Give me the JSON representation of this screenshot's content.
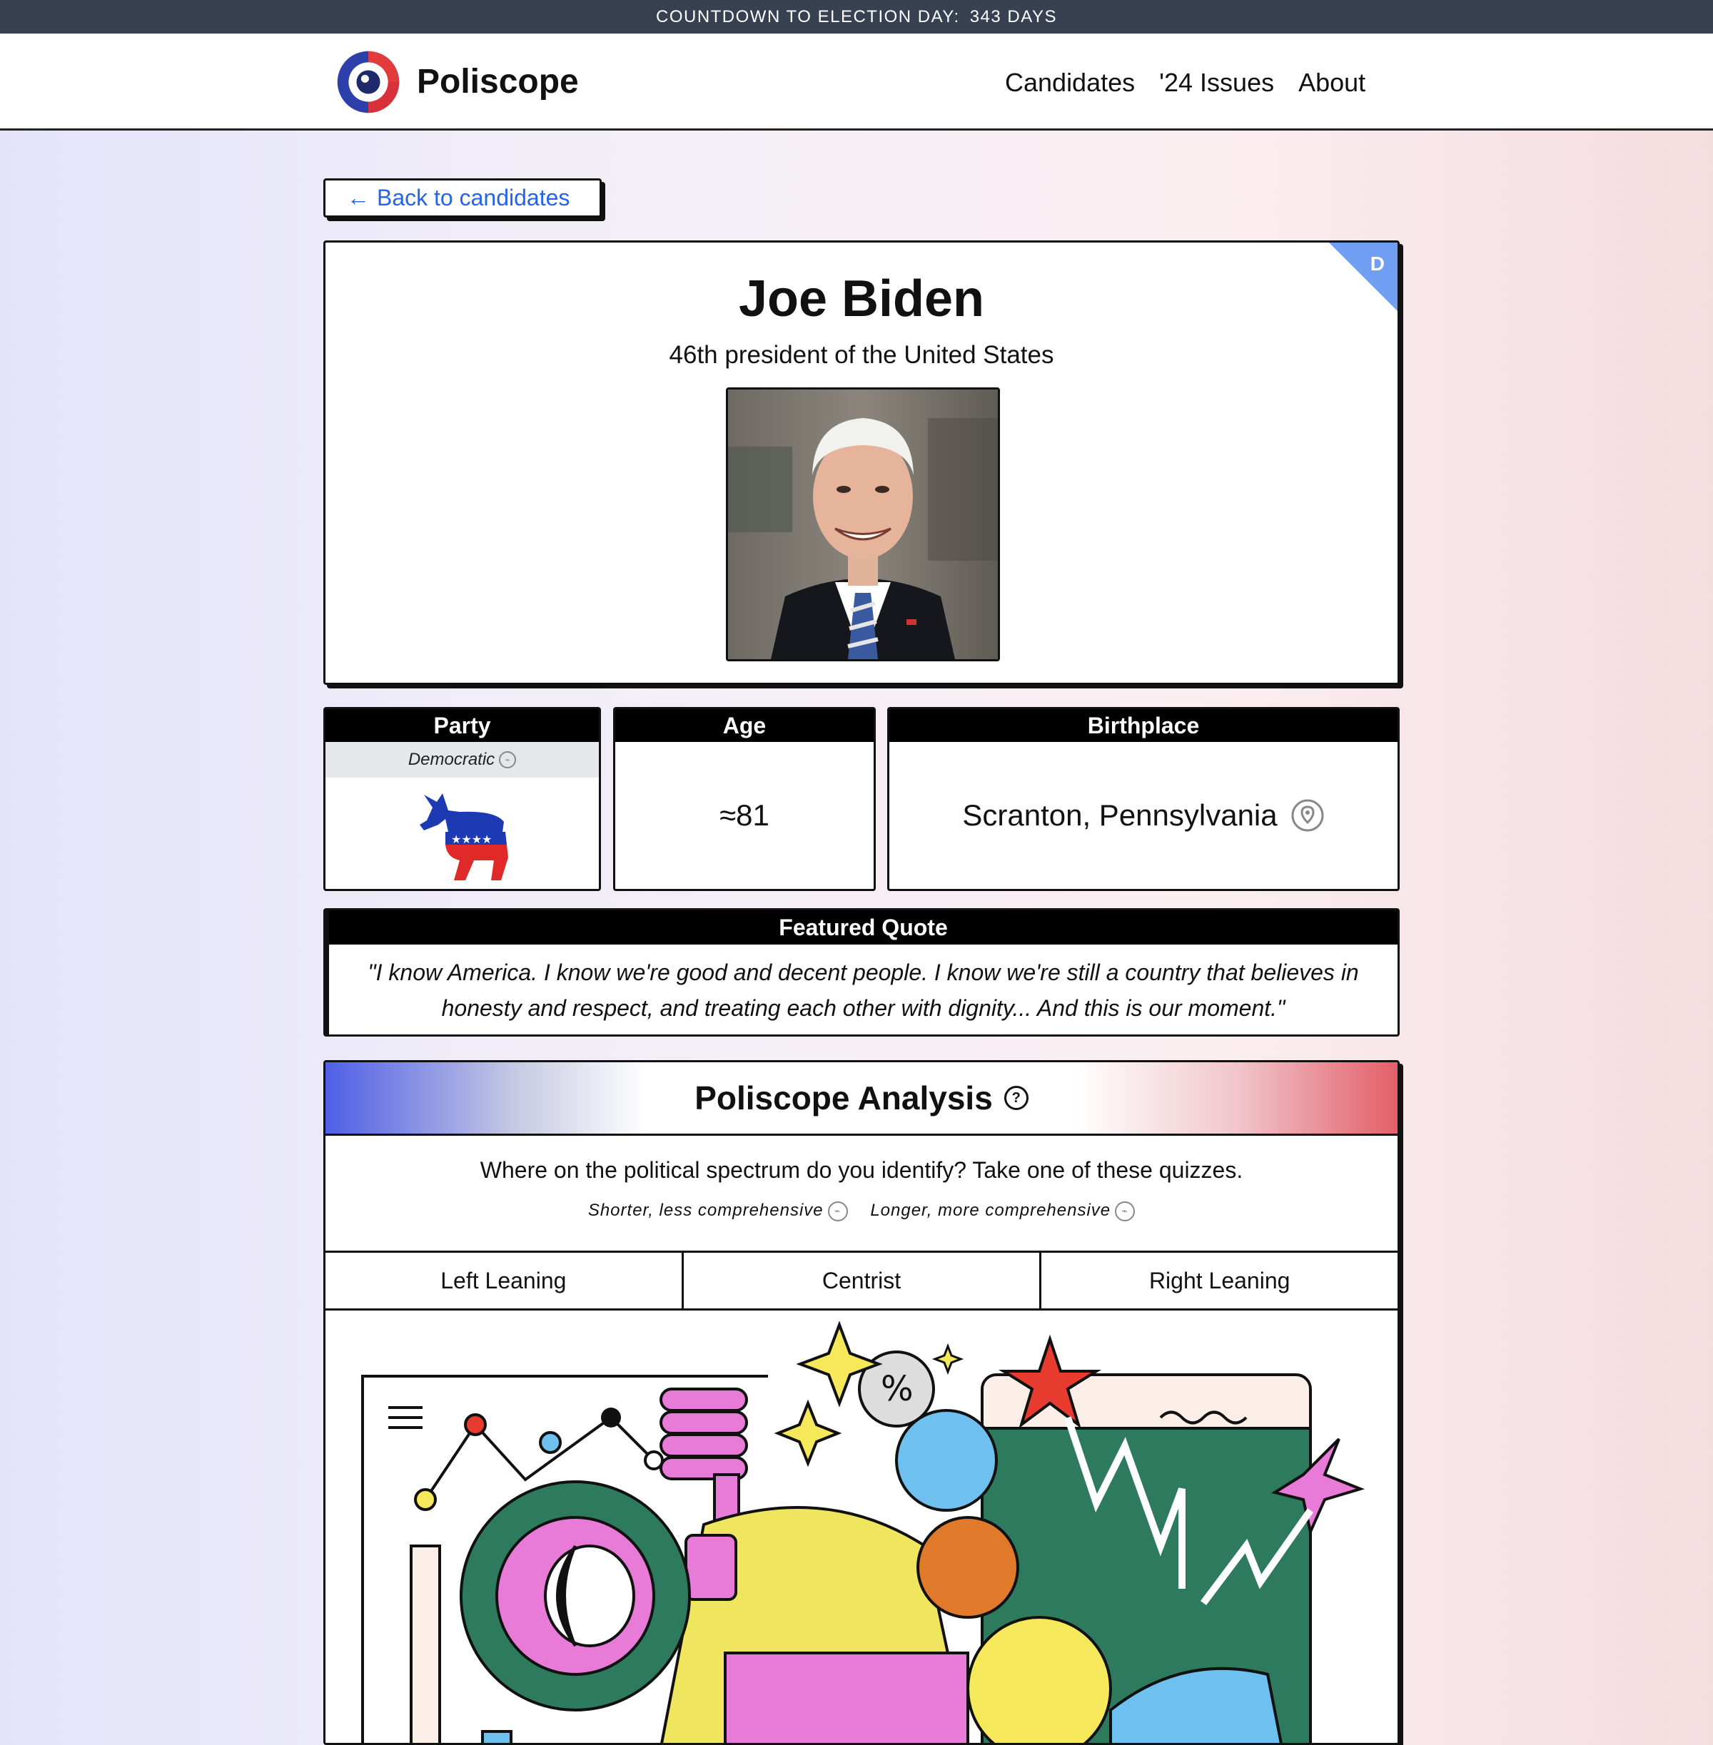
{
  "countdown": {
    "label": "COUNTDOWN TO ELECTION DAY:",
    "days": "343 DAYS"
  },
  "nav": {
    "brand": "Poliscope",
    "links": [
      "Candidates",
      "'24 Issues",
      "About"
    ]
  },
  "back_button": {
    "arrow": "←",
    "label": "Back to candidates"
  },
  "candidate": {
    "party_badge": "D",
    "name": "Joe Biden",
    "title": "46th president of the United States",
    "party_header": "Party",
    "party": "Democratic",
    "age_header": "Age",
    "age": "≈81",
    "birthplace_header": "Birthplace",
    "birthplace": "Scranton, Pennsylvania"
  },
  "quote": {
    "header": "Featured Quote",
    "text": "\"I know America. I know we're good and decent people. I know we're still a country that believes in honesty and respect, and treating each other with dignity... And this is our moment.\""
  },
  "analysis": {
    "title": "Poliscope Analysis",
    "question": "Where on the political spectrum do you identify? Take one of these quizzes.",
    "quiz_short": "Shorter, less comprehensive",
    "quiz_long": "Longer, more comprehensive",
    "leanings": [
      "Left Leaning",
      "Centrist",
      "Right Leaning"
    ]
  },
  "colors": {
    "democratic_blue": "#6f9ef2",
    "topbar": "#374151",
    "accent_link": "#2563eb"
  }
}
